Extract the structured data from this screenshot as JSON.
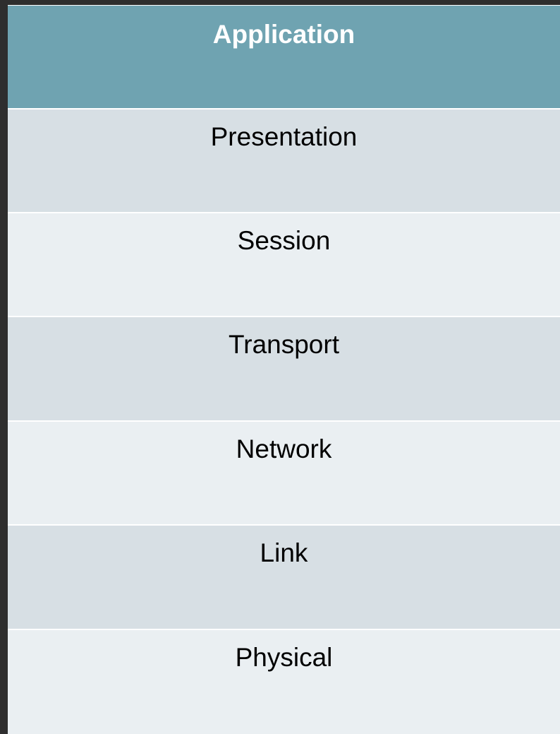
{
  "layers": {
    "header": "Application",
    "items": [
      "Presentation",
      "Session",
      "Transport",
      "Network",
      "Link",
      "Physical"
    ]
  }
}
